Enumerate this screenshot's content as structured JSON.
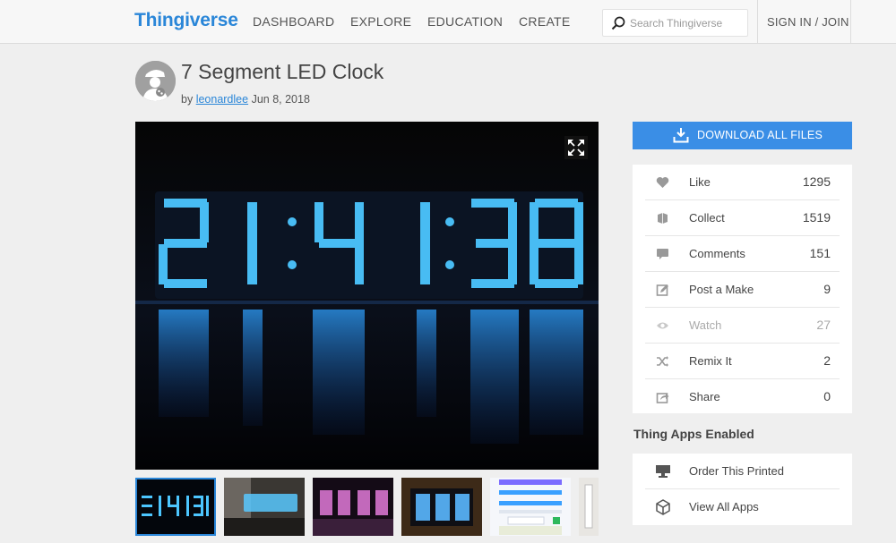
{
  "header": {
    "logo": "Thingiverse",
    "nav": [
      "DASHBOARD",
      "EXPLORE",
      "EDUCATION",
      "CREATE"
    ],
    "search_placeholder": "Search Thingiverse",
    "signin": "SIGN IN / JOIN"
  },
  "thing": {
    "title": "7 Segment LED Clock",
    "by": "by",
    "author": "leonardlee",
    "date": "Jun 8, 2018"
  },
  "sidebar": {
    "download_label": "DOWNLOAD ALL FILES",
    "stats": [
      {
        "label": "Like",
        "count": "1295",
        "icon": "heart-icon"
      },
      {
        "label": "Collect",
        "count": "1519",
        "icon": "collect-icon"
      },
      {
        "label": "Comments",
        "count": "151",
        "icon": "comments-icon"
      },
      {
        "label": "Post a Make",
        "count": "9",
        "icon": "post-make-icon"
      },
      {
        "label": "Watch",
        "count": "27",
        "icon": "eye-icon"
      },
      {
        "label": "Remix It",
        "count": "2",
        "icon": "shuffle-icon"
      },
      {
        "label": "Share",
        "count": "0",
        "icon": "share-icon"
      }
    ],
    "apps_heading": "Thing Apps Enabled",
    "apps": [
      {
        "label": "Order This Printed",
        "icon": "printer-icon"
      },
      {
        "label": "View All Apps",
        "icon": "cube-icon"
      }
    ]
  },
  "colors": {
    "brand": "#2a86d8",
    "download": "#3a8ee6",
    "led": "#4cc6ff"
  }
}
